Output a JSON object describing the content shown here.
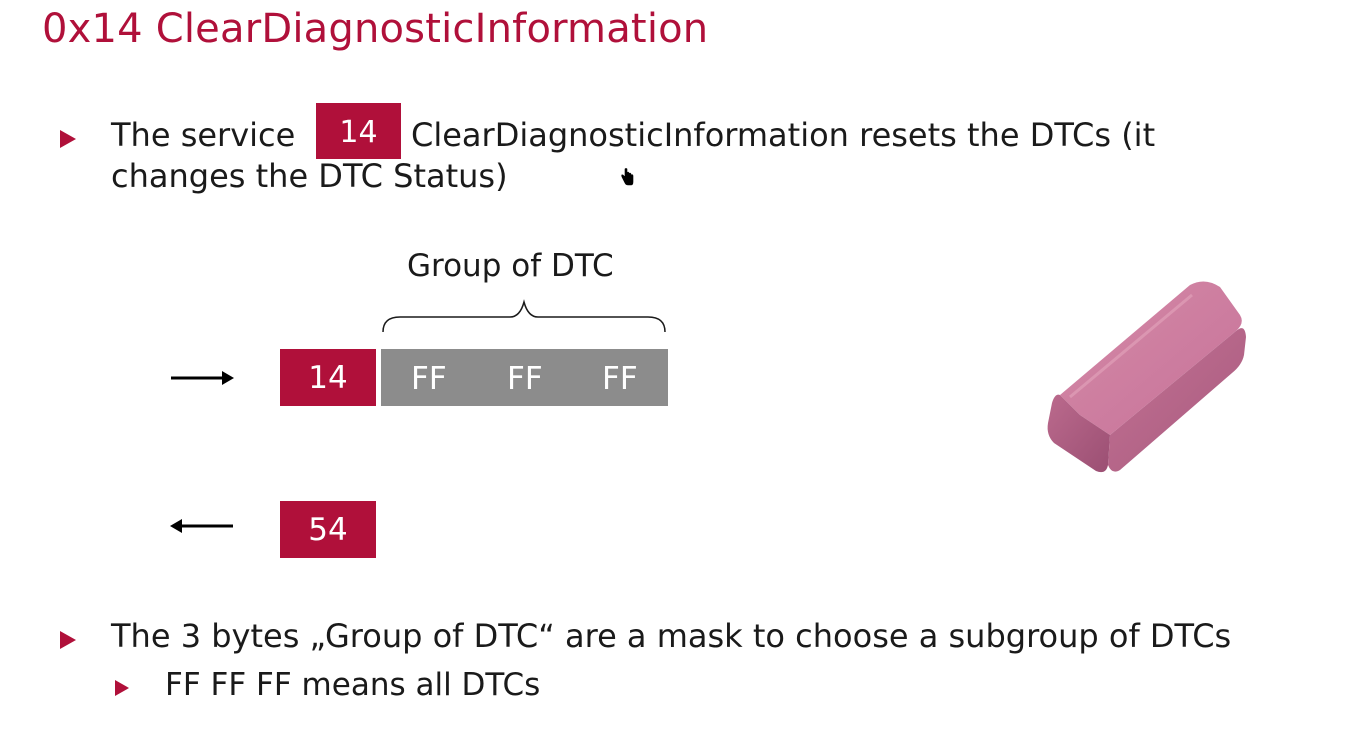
{
  "slide": {
    "title": "0x14 ClearDiagnosticInformation",
    "accent_color": "#b0103a",
    "bullet1": {
      "prefix": "The service",
      "badge": "14",
      "suffix": "ClearDiagnosticInformation resets the DTCs (it",
      "line2": "changes the DTC Status)"
    },
    "diagram": {
      "group_label": "Group of DTC",
      "request_byte": "14",
      "group_bytes": [
        "FF",
        "FF",
        "FF"
      ],
      "response_byte": "54",
      "request_arrow_icon": "arrow-right-icon",
      "response_arrow_icon": "arrow-left-icon"
    },
    "bullet2": {
      "text": "The 3 bytes „Group of DTC“ are a mask to choose a subgroup of DTCs",
      "sub": "FF FF FF means all DTCs"
    },
    "image": {
      "icon": "eraser-image"
    },
    "cursor_icon": "hand-cursor-icon"
  }
}
